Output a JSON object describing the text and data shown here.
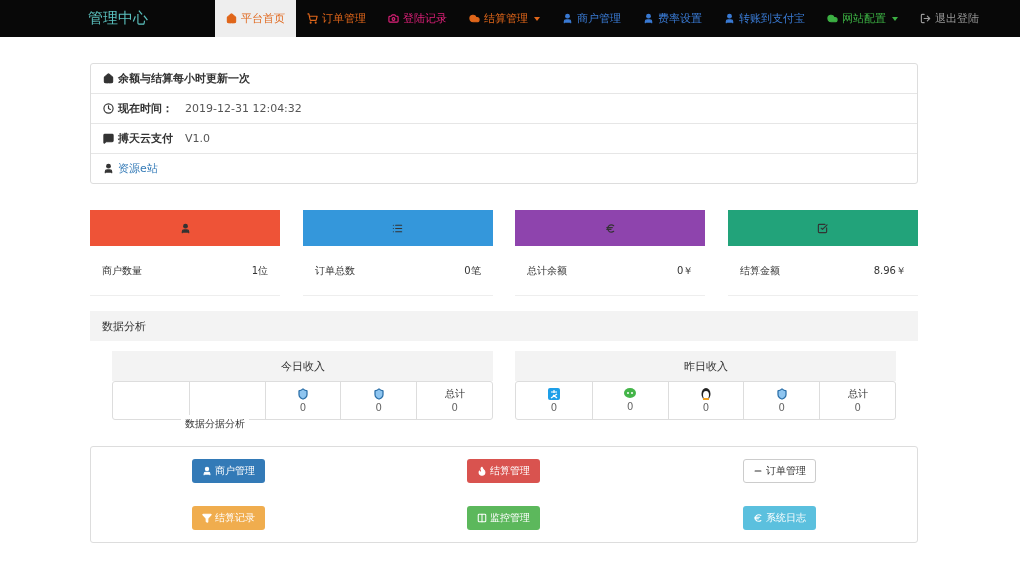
{
  "navbar": {
    "brand": "管理中心",
    "items": [
      {
        "label": "平台首页",
        "selected": true,
        "dropdown": false
      },
      {
        "label": "订单管理",
        "selected": false,
        "dropdown": false
      },
      {
        "label": "登陆记录",
        "selected": false,
        "dropdown": false
      },
      {
        "label": "结算管理",
        "selected": false,
        "dropdown": true
      },
      {
        "label": "商户管理",
        "selected": false,
        "dropdown": false
      },
      {
        "label": "费率设置",
        "selected": false,
        "dropdown": false
      },
      {
        "label": "转账到支付宝",
        "selected": false,
        "dropdown": false
      },
      {
        "label": "网站配置",
        "selected": false,
        "dropdown": true
      },
      {
        "label": "退出登陆",
        "selected": false,
        "dropdown": false
      }
    ]
  },
  "info": [
    {
      "label": "余额与结算每小时更新一次",
      "kind": "plain"
    },
    {
      "label": "现在时间：",
      "value": "2019-12-31 12:04:32",
      "kind": "plain"
    },
    {
      "label": "搏天云支付",
      "value": "V1.0",
      "kind": "plain"
    },
    {
      "label": "资源e站",
      "kind": "link"
    }
  ],
  "stats": [
    {
      "color": "#ee5337",
      "label": "商户数量",
      "value": "1位"
    },
    {
      "color": "#3497db",
      "label": "订单总数",
      "value": "0笔"
    },
    {
      "color": "#8e44ad",
      "label": "总计余额",
      "value": "0￥"
    },
    {
      "color": "#22a37a",
      "label": "结算金额",
      "value": "8.96￥"
    }
  ],
  "analysis": {
    "title": "数据分析",
    "overlay": "数据分据分析"
  },
  "income": [
    {
      "title": "今日收入",
      "cells": [
        {},
        {},
        {
          "value": "0"
        },
        {
          "value": "0"
        },
        {
          "caption": "总计",
          "value": "0"
        }
      ]
    },
    {
      "title": "昨日收入",
      "cells": [
        {
          "value": "0"
        },
        {
          "value": "0"
        },
        {
          "value": "0"
        },
        {
          "value": "0"
        },
        {
          "caption": "总计",
          "value": "0"
        }
      ]
    }
  ],
  "actions": [
    {
      "label": "商户管理",
      "kind": "primary"
    },
    {
      "label": "结算管理",
      "kind": "danger"
    },
    {
      "label": "订单管理",
      "kind": "default"
    },
    {
      "label": "结算记录",
      "kind": "warning"
    },
    {
      "label": "监控管理",
      "kind": "success"
    },
    {
      "label": "系统日志",
      "kind": "info"
    }
  ]
}
